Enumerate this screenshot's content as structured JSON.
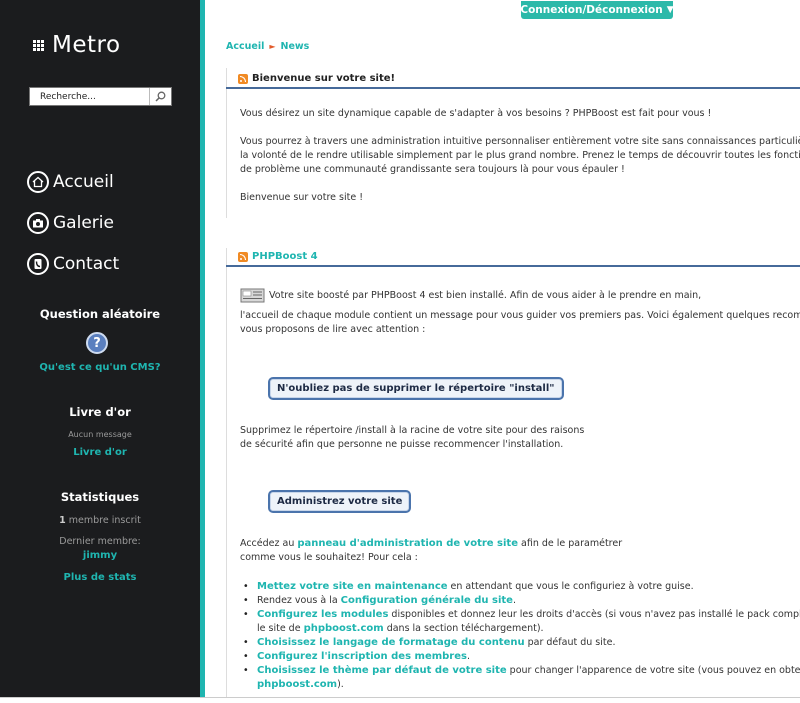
{
  "sidebar": {
    "logo": "Metro",
    "search_placeholder": "Recherche...",
    "nav": [
      {
        "label": "Accueil",
        "icon": "home-icon"
      },
      {
        "label": "Galerie",
        "icon": "camera-icon"
      },
      {
        "label": "Contact",
        "icon": "phone-icon"
      }
    ],
    "question": {
      "title": "Question aléatoire",
      "link": "Qu'est ce qu'un CMS?"
    },
    "guestbook": {
      "title": "Livre d'or",
      "empty": "Aucun message",
      "link": "Livre d'or"
    },
    "stats": {
      "title": "Statistiques",
      "members_count": "1",
      "members_label": " membre inscrit",
      "last_member_label": "Dernier membre:",
      "last_member": "jimmy",
      "more_link": "Plus de stats"
    }
  },
  "header": {
    "login_button": "Connexion/Déconnexion"
  },
  "breadcrumb": {
    "home": "Accueil",
    "current": "News"
  },
  "news": [
    {
      "title": "Bienvenue sur votre site!",
      "lines": [
        "Vous désirez un site dynamique capable de s'adapter à vos besoins ? PHPBoost est fait pour vous !",
        "Vous pourrez à travers une administration intuitive personnaliser entièrement votre site sans connaissances particulières. En",
        "la volonté de le rendre utilisable simplement par le plus grand nombre. Prenez le temps de découvrir toutes les fonctionnal",
        "de problème une communauté grandissante sera toujours là pour vous épauler !",
        "Bienvenue sur votre site !"
      ]
    },
    {
      "title": "PHPBoost 4",
      "intro_1": "Votre site boosté par PHPBoost 4 est bien installé. Afin de vous aider à le prendre en main,",
      "intro_2": "l'accueil de chaque module contient un message pour vous guider vos premiers pas. Voici également quelques recommand",
      "intro_3": "vous proposons de lire avec attention :",
      "box1": "N'oubliez pas de supprimer le répertoire \"install\"",
      "box1_text_1": "Supprimez le répertoire /install à la racine de votre site pour des raisons",
      "box1_text_2": "de sécurité afin que personne ne puisse recommencer l'installation.",
      "box2": "Administrez votre site",
      "admin_pre": "Accédez au ",
      "admin_link": "panneau d'administration de votre site",
      "admin_post": " afin de le paramétrer",
      "admin_line2": "comme vous le souhaitez! Pour cela :",
      "tasks": [
        {
          "link": "Mettez votre site en maintenance",
          "post": " en attendant que vous le configuriez à votre guise."
        },
        {
          "pre": "Rendez vous à la ",
          "link": "Configuration générale du site",
          "post": "."
        },
        {
          "link": "Configurez les modules",
          "post": " disponibles et donnez leur les droits d'accès (si vous n'avez pas installé le pack complet, tous"
        },
        {
          "pre": "le site de ",
          "link": "phpboost.com",
          "post": " dans la section téléchargement)."
        },
        {
          "link": "Choisissez le langage de formatage du contenu",
          "post": " par défaut du site."
        },
        {
          "link": "Configurez l'inscription des membres",
          "post": "."
        },
        {
          "link": "Choisissez le thème par défaut de votre site",
          "post": " pour changer l'apparence de votre site (vous pouvez en obtenir d'au"
        },
        {
          "link": "phpboost.com",
          "post": ")."
        }
      ]
    }
  ],
  "colors": {
    "accent": "#1fb5b0",
    "sidebar_bg": "#1b1c1e",
    "heading_rule": "#466a9a",
    "rss": "#f08a24"
  }
}
